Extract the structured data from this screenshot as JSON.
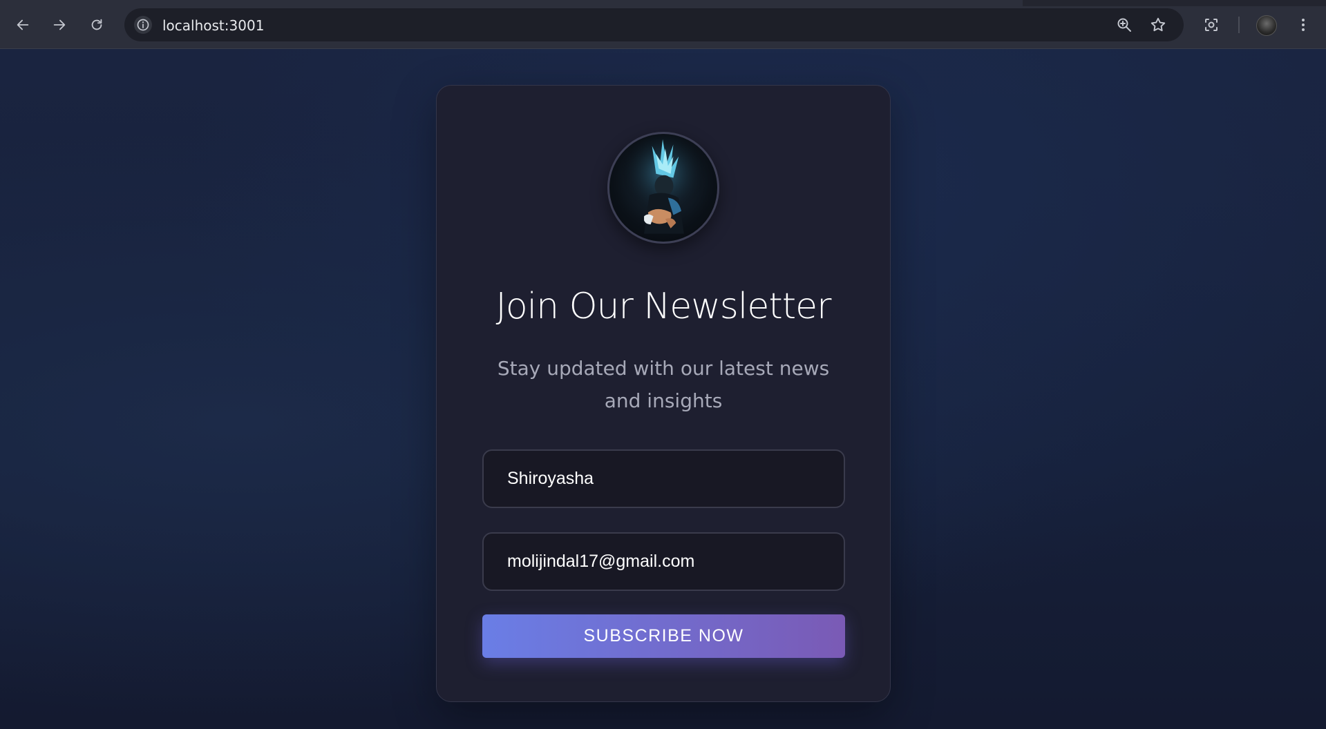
{
  "browser": {
    "url": "localhost:3001",
    "icons": {
      "back": "arrow-left-icon",
      "forward": "arrow-right-icon",
      "reload": "reload-icon",
      "site_info": "info-icon",
      "zoom": "zoom-in-icon",
      "bookmark": "star-icon",
      "screenshot": "lens-icon",
      "profile": "profile-avatar",
      "menu": "kebab-menu-icon"
    }
  },
  "newsletter": {
    "title": "Join Our Newsletter",
    "subtitle": "Stay updated with our latest news and insights",
    "name_value": "Shiroyasha",
    "email_value": "molijindal17@gmail.com",
    "button_label": "SUBSCRIBE NOW",
    "colors": {
      "card_bg": "#1e1f30",
      "button_gradient_start": "#6a7ee6",
      "button_gradient_end": "#7a5ab5"
    }
  }
}
